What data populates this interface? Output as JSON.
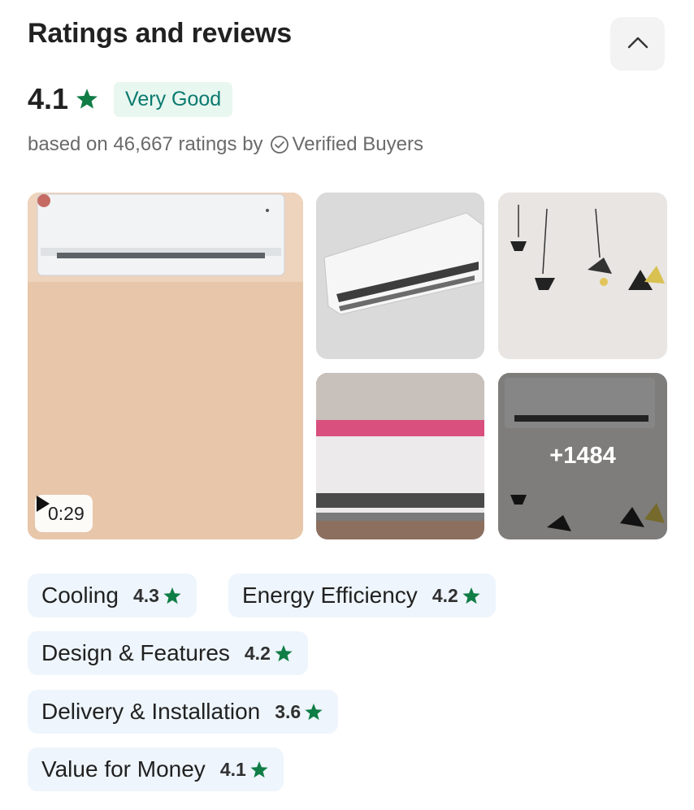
{
  "header": {
    "title": "Ratings and reviews",
    "collapse_icon": "chevron-up-icon"
  },
  "summary": {
    "rating": "4.1",
    "star_icon": "star-icon",
    "label": "Very Good",
    "based_on_text": "based on 46,667 ratings by",
    "verified_icon": "check-circle-icon",
    "verified_text": "Verified Buyers",
    "star_color": "#0f7d45",
    "badge_bg": "#e8f7ef",
    "badge_color": "#0b7a70"
  },
  "media": {
    "video_duration": "0:29",
    "play_icon": "play-icon",
    "more_count": "+1484"
  },
  "attributes": [
    {
      "label": "Cooling",
      "score": "4.3"
    },
    {
      "label": "Energy Efficiency",
      "score": "4.2"
    },
    {
      "label": "Design & Features",
      "score": "4.2"
    },
    {
      "label": "Delivery & Installation",
      "score": "3.6"
    },
    {
      "label": "Value for Money",
      "score": "4.1"
    }
  ]
}
